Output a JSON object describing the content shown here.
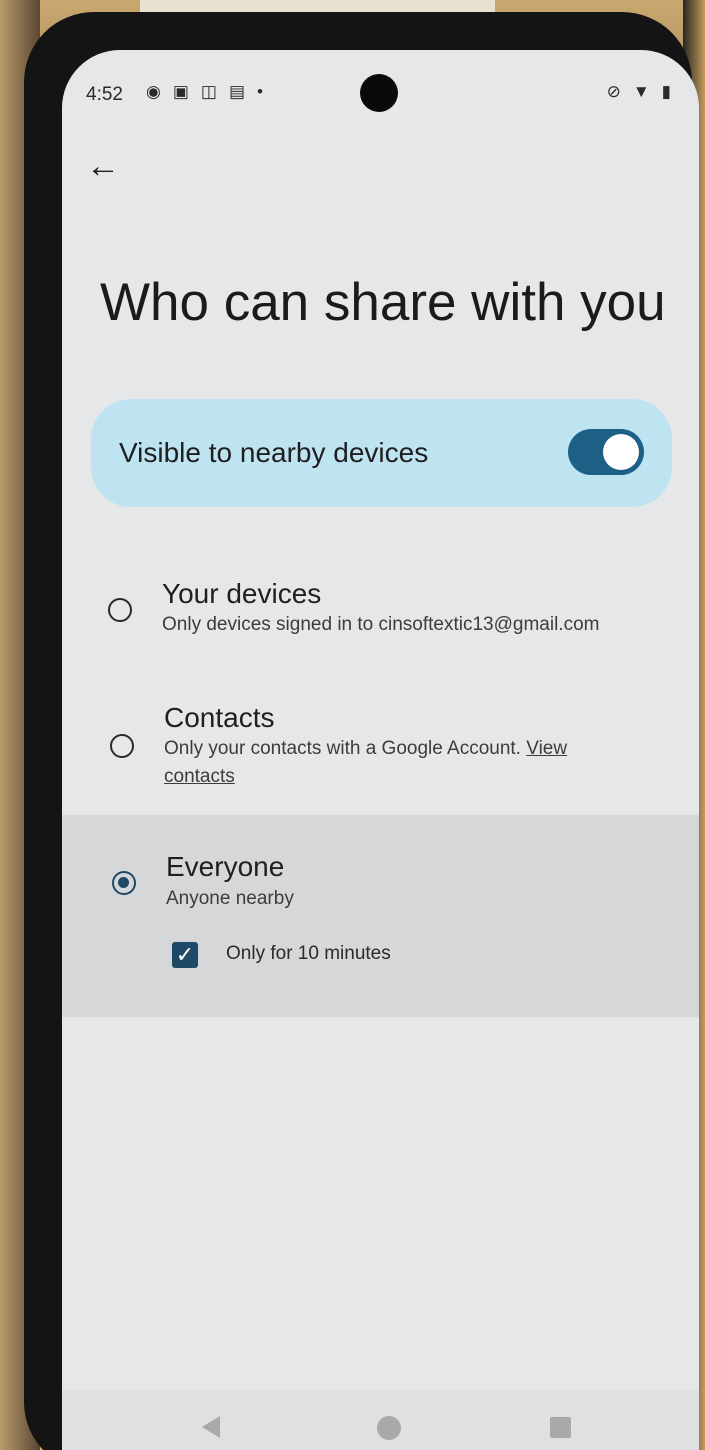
{
  "status": {
    "time": "4:52",
    "left_icons": [
      "◉",
      "▣",
      "◫",
      "▤",
      "•"
    ],
    "right_icons": [
      "⊘",
      "▼",
      "▮"
    ]
  },
  "header": {
    "back_icon": "←",
    "title": "Who can share with you"
  },
  "visibility": {
    "label": "Visible to nearby devices",
    "toggle_on": true,
    "accent": "#1e5f85"
  },
  "options": [
    {
      "title": "Your devices",
      "subtitle": "Only devices signed in to cinsoftextic13@gmail.com",
      "selected": false
    },
    {
      "title": "Contacts",
      "subtitle": "Only your contacts with a Google Account.",
      "link": "View",
      "link2": "contacts",
      "selected": false
    },
    {
      "title": "Everyone",
      "subtitle": "Anyone nearby",
      "selected": true,
      "checkbox_label": "Only for 10 minutes",
      "checkbox_checked": true
    }
  ],
  "nav": {
    "back": "◀",
    "home": "●",
    "recents": "■"
  }
}
